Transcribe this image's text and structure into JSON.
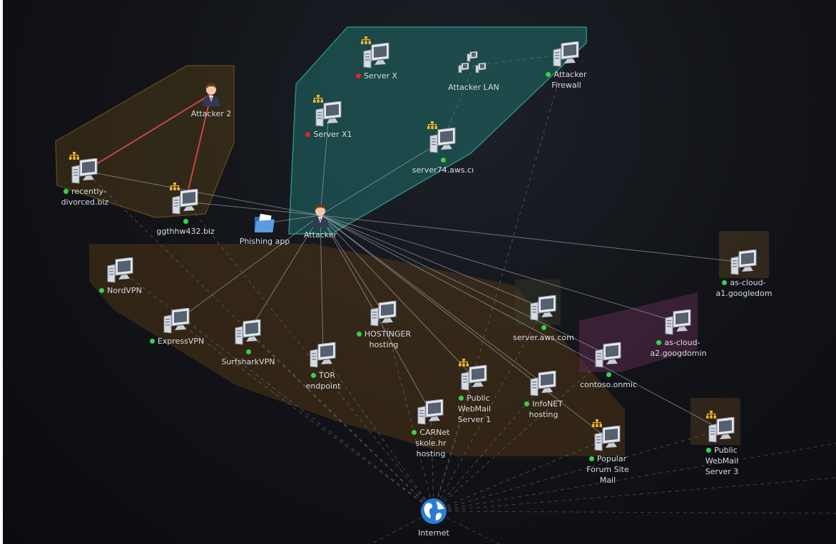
{
  "diagram": {
    "nodes": [
      {
        "id": "server-x",
        "label": "Server X",
        "type": "server",
        "status": "red",
        "hier": true
      },
      {
        "id": "attacker-lan",
        "label": "Attacker LAN",
        "type": "lan",
        "status": "",
        "hier": false
      },
      {
        "id": "attacker-firewall",
        "label": "Attacker\nFirewall",
        "type": "server",
        "status": "green",
        "hier": false
      },
      {
        "id": "server-x1",
        "label": "Server X1",
        "type": "server",
        "status": "red",
        "hier": true
      },
      {
        "id": "server74",
        "label": "server74.aws.cı",
        "type": "server",
        "status": "green-above",
        "hier": true
      },
      {
        "id": "attacker-2",
        "label": "Attacker 2",
        "type": "person",
        "status": "",
        "hier": false
      },
      {
        "id": "recently-divorced",
        "label": "recently-\ndivorced.biz",
        "type": "server",
        "status": "green",
        "hier": true
      },
      {
        "id": "ggthhw432",
        "label": "ggthhw432.biz",
        "type": "server",
        "status": "green-above",
        "hier": true
      },
      {
        "id": "phishing-app",
        "label": "Phishing app",
        "type": "folder",
        "status": "",
        "hier": false
      },
      {
        "id": "attacker",
        "label": "Attacker",
        "type": "person",
        "status": "",
        "hier": false
      },
      {
        "id": "nordvpn",
        "label": "NordVPN",
        "type": "server",
        "status": "green",
        "hier": false
      },
      {
        "id": "expressvpn",
        "label": "ExpressVPN",
        "type": "server",
        "status": "green",
        "hier": false
      },
      {
        "id": "surfsharkvpn",
        "label": "SurfsharkVPN",
        "type": "server",
        "status": "green-above",
        "hier": false
      },
      {
        "id": "tor-endpoint",
        "label": "TOR\nendpoint",
        "type": "server",
        "status": "green",
        "hier": false
      },
      {
        "id": "hostinger",
        "label": "HOSTINGER\nhosting",
        "type": "server",
        "status": "green",
        "hier": false
      },
      {
        "id": "carnet",
        "label": "CARNet\nskole.hr\nhosting",
        "type": "server",
        "status": "green",
        "hier": false
      },
      {
        "id": "public-webmail-1",
        "label": "Public\nWebMail\nServer 1",
        "type": "server",
        "status": "green",
        "hier": true
      },
      {
        "id": "infonet",
        "label": "InfoNET\nhosting",
        "type": "server",
        "status": "green",
        "hier": false
      },
      {
        "id": "server-aws",
        "label": "server.aws.com",
        "type": "server",
        "status": "green-above",
        "hier": false
      },
      {
        "id": "contoso",
        "label": "contoso.onmic",
        "type": "server",
        "status": "green-above",
        "hier": false
      },
      {
        "id": "as-cloud-a1",
        "label": "as-cloud-\na1.googledom",
        "type": "server",
        "status": "green",
        "hier": false
      },
      {
        "id": "as-cloud-a2",
        "label": "as-cloud-\na2.googdomin",
        "type": "server",
        "status": "green",
        "hier": false
      },
      {
        "id": "popular-forum",
        "label": "Popular\nForum Site\nMail",
        "type": "server",
        "status": "green",
        "hier": true
      },
      {
        "id": "public-webmail-3",
        "label": "Public\nWebMail\nServer 3",
        "type": "server",
        "status": "green",
        "hier": true
      },
      {
        "id": "internet",
        "label": "Internet",
        "type": "globe",
        "status": "",
        "hier": false
      }
    ],
    "links": [
      {
        "from": "attacker-2",
        "to": "recently-divorced",
        "style": "red"
      },
      {
        "from": "attacker-2",
        "to": "ggthhw432",
        "style": "red"
      },
      {
        "from": "attacker",
        "to": "recently-divorced",
        "style": "solid"
      },
      {
        "from": "attacker",
        "to": "ggthhw432",
        "style": "solid"
      },
      {
        "from": "attacker",
        "to": "phishing-app",
        "style": "solid"
      },
      {
        "from": "attacker",
        "to": "server74",
        "style": "solid"
      },
      {
        "from": "attacker",
        "to": "server-x1",
        "style": "solid"
      },
      {
        "from": "attacker",
        "to": "expressvpn",
        "style": "solid"
      },
      {
        "from": "attacker",
        "to": "surfsharkvpn",
        "style": "solid"
      },
      {
        "from": "attacker",
        "to": "tor-endpoint",
        "style": "solid"
      },
      {
        "from": "attacker",
        "to": "hostinger",
        "style": "solid"
      },
      {
        "from": "attacker",
        "to": "carnet",
        "style": "solid"
      },
      {
        "from": "attacker",
        "to": "public-webmail-1",
        "style": "solid"
      },
      {
        "from": "attacker",
        "to": "infonet",
        "style": "solid"
      },
      {
        "from": "attacker",
        "to": "server-aws",
        "style": "solid"
      },
      {
        "from": "attacker",
        "to": "contoso",
        "style": "solid"
      },
      {
        "from": "attacker",
        "to": "as-cloud-a1",
        "style": "solid"
      },
      {
        "from": "attacker",
        "to": "as-cloud-a2",
        "style": "solid"
      },
      {
        "from": "attacker",
        "to": "popular-forum",
        "style": "solid"
      },
      {
        "from": "attacker",
        "to": "public-webmail-3",
        "style": "solid"
      },
      {
        "from": "attacker-lan",
        "to": "attacker-firewall",
        "style": "dashed"
      },
      {
        "from": "attacker-lan",
        "to": "server74",
        "style": "dashed"
      },
      {
        "from": "attacker-firewall",
        "to": "internet",
        "style": "dashed"
      },
      {
        "from": "internet",
        "to": "nordvpn",
        "style": "dashed"
      },
      {
        "from": "internet",
        "to": "expressvpn",
        "style": "dashed"
      },
      {
        "from": "internet",
        "to": "surfsharkvpn",
        "style": "dashed"
      },
      {
        "from": "internet",
        "to": "tor-endpoint",
        "style": "dashed"
      },
      {
        "from": "internet",
        "to": "hostinger",
        "style": "dashed"
      },
      {
        "from": "internet",
        "to": "carnet",
        "style": "dashed"
      },
      {
        "from": "internet",
        "to": "public-webmail-1",
        "style": "dashed"
      },
      {
        "from": "internet",
        "to": "infonet",
        "style": "dashed"
      },
      {
        "from": "internet",
        "to": "server-aws",
        "style": "dashed"
      },
      {
        "from": "internet",
        "to": "contoso",
        "style": "dashed"
      },
      {
        "from": "internet",
        "to": "popular-forum",
        "style": "dashed"
      },
      {
        "from": "internet",
        "to": "public-webmail-3",
        "style": "dashed"
      },
      {
        "from": "internet",
        "to": "recently-divorced",
        "style": "dashed"
      },
      {
        "from": "internet",
        "to": "ggthhw432",
        "style": "dashed"
      }
    ],
    "colors": {
      "status_green": "#37d24a",
      "status_red": "#e0242a",
      "group_attacker_infra": "#1f6e6a",
      "group_attacker2": "#6b4d17",
      "group_hosting": "#6a4515",
      "group_googledom": "#5a2a4a",
      "link_red": "#c94646",
      "hierarchy_icon": "#f0b52a"
    }
  }
}
